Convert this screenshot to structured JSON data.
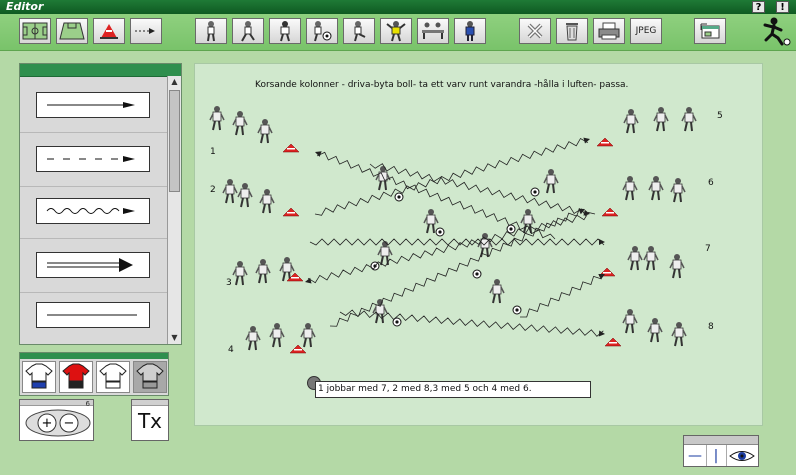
{
  "window": {
    "title": "Editor",
    "help_btn": "?",
    "alert_btn": "!"
  },
  "toolbar": {
    "jpeg_label": "JPEG",
    "buttons": [
      "full-pitch-icon",
      "half-pitch-icon",
      "cone-icon",
      "arrow-line-icon",
      "player-icon-1",
      "player-icon-2",
      "player-icon-3",
      "player-with-ball-icon",
      "player-icon-5",
      "goalkeeper-icon",
      "bench-icon",
      "coach-icon",
      "delete-icon",
      "trash-icon",
      "printer-icon",
      "jpeg-export-icon",
      "window-icon"
    ]
  },
  "palette": {
    "items": [
      "solid-arrow-line",
      "dashed-arrow-line",
      "wavy-arrow-line",
      "double-arrow-line",
      "plain-line"
    ]
  },
  "kits": {
    "selected": 3,
    "colors": [
      "#1f3fae",
      "#d11",
      "#ffffff",
      "#8a8a8a"
    ]
  },
  "zoom": {
    "number": "6"
  },
  "text_tool": {
    "label": "Tx"
  },
  "view_controls": {
    "labels": [
      "—",
      "|"
    ]
  },
  "drawing": {
    "caption": "Korsande kolonner - driva-byta boll- ta ett varv runt varandra -hålla i luften- passa.",
    "group_labels": [
      "1",
      "2",
      "3",
      "4",
      "5",
      "6",
      "7",
      "8"
    ],
    "note": "1 jobbar med  7, 2 med 8,3 med 5 och 4 med 6."
  }
}
